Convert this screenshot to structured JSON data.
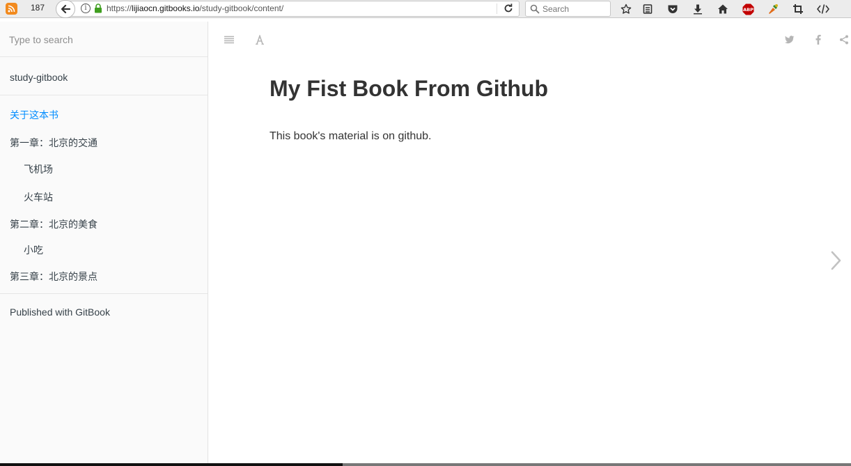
{
  "browser": {
    "rss_count": "187",
    "url_prefix": "https://",
    "url_host": "lijiaocn.gitbooks.io",
    "url_path": "/study-gitbook/content/",
    "search_placeholder": "Search"
  },
  "sidebar": {
    "search_placeholder": "Type to search",
    "book_title": "study-gitbook",
    "items": [
      {
        "label": "关于这本书"
      },
      {
        "label": "第一章：北京的交通"
      },
      {
        "label": "飞机场"
      },
      {
        "label": "火车站"
      },
      {
        "label": "第二章：北京的美食"
      },
      {
        "label": "小吃"
      },
      {
        "label": "第三章：北京的景点"
      }
    ],
    "published": "Published with GitBook"
  },
  "content": {
    "title": "My Fist Book From Github",
    "body": "This book's material is on github."
  },
  "colors": {
    "active_link": "#008cff",
    "sidebar_bg": "#fafafa",
    "text": "#333333"
  }
}
